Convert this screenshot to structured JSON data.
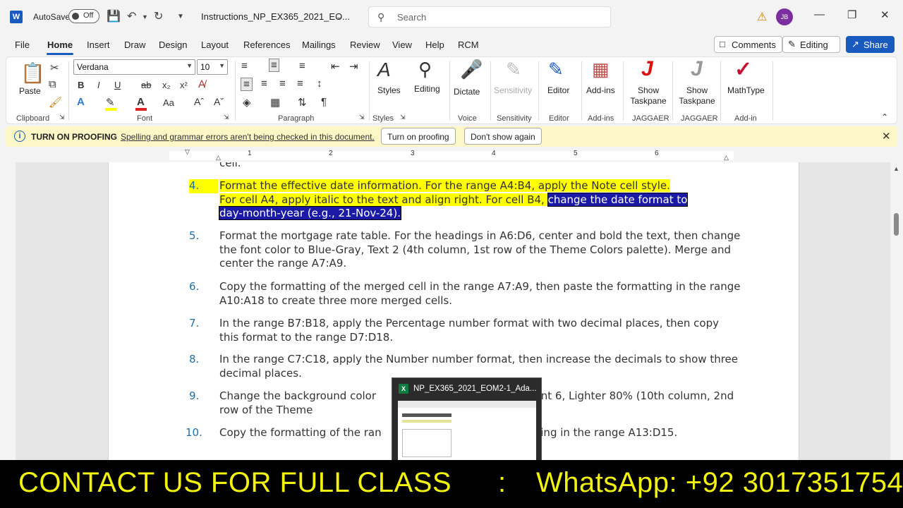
{
  "titlebar": {
    "app_logo": "W",
    "autosave_label": "AutoSave",
    "autosave_state": "Off",
    "doc_title": "Instructions_NP_EX365_2021_EO...",
    "search_placeholder": "Search",
    "avatar_initials": "JB"
  },
  "menu": {
    "tabs": [
      "File",
      "Home",
      "Insert",
      "Draw",
      "Design",
      "Layout",
      "References",
      "Mailings",
      "Review",
      "View",
      "Help",
      "RCM"
    ],
    "comments": "Comments",
    "editing": "Editing",
    "share": "Share"
  },
  "ribbon": {
    "paste": "Paste",
    "font_name": "Verdana",
    "font_size": "10",
    "styles": "Styles",
    "editing": "Editing",
    "dictate": "Dictate",
    "sensitivity": "Sensitivity",
    "editor": "Editor",
    "addins": "Add-ins",
    "show_taskpane_1": "Show Taskpane",
    "show_taskpane_2": "Show Taskpane",
    "mathtype": "MathType",
    "groups": {
      "clipboard": "Clipboard",
      "font": "Font",
      "paragraph": "Paragraph",
      "styles": "Styles",
      "voice": "Voice",
      "sensitivity": "Sensitivity",
      "editor": "Editor",
      "addins": "Add-ins",
      "jaggaer1": "JAGGAER",
      "jaggaer2": "JAGGAER",
      "addin": "Add-in"
    }
  },
  "proofing": {
    "title": "TURN ON PROOFING",
    "message": "Spelling and grammar errors aren't being checked in this document.",
    "turn_on": "Turn on proofing",
    "dont_show": "Don't show again"
  },
  "ruler": [
    "1",
    "2",
    "3",
    "4",
    "5",
    "6"
  ],
  "document": {
    "top_fragment": "cell.",
    "items": [
      {
        "num": "4.",
        "line1": "Format the effective date information. For the range A4:B4, apply the Note cell style.",
        "line2a": "For cell A4, apply italic to the text and align right. For cell B4, ",
        "line2b": "change the date format to",
        "line3": "day-month-year (e.g., 21-Nov-24)."
      },
      {
        "num": "5.",
        "text": "Format the mortgage rate table. For the headings in A6:D6, center and bold the text, then change the font color to Blue-Gray, Text 2 (4th column, 1st row of the Theme Colors palette). Merge and center the range A7:A9."
      },
      {
        "num": "6.",
        "text": "Copy the formatting of the merged cell in the range A7:A9, then paste the formatting in the range A10:A18 to create three more merged cells."
      },
      {
        "num": "7.",
        "text": "In the range B7:B18, apply the Percentage number format with two decimal places, then copy this format to the range D7:D18."
      },
      {
        "num": "8.",
        "text": "In the range C7:C18, apply the Number number format, then increase the decimals to show three decimal places."
      },
      {
        "num": "9.",
        "text": "Change the background color            en, Accent 6, Lighter 80% (10th column, 2nd row of the Theme"
      },
      {
        "num": "10.",
        "text": "Copy the formatting of the ran            formatting in the range A13:D15."
      }
    ]
  },
  "taskbar_thumb": {
    "title": "NP_EX365_2021_EOM2-1_Ada..."
  },
  "banner": {
    "left": "CONTACT US FOR FULL CLASS",
    "colon": ":",
    "right": "WhatsApp:  +92 3017351754"
  },
  "colors": {
    "accent": "#185abd",
    "highlight": "#ffff00",
    "selection": "#1a1aa6",
    "banner_text": "#f2f20f"
  }
}
